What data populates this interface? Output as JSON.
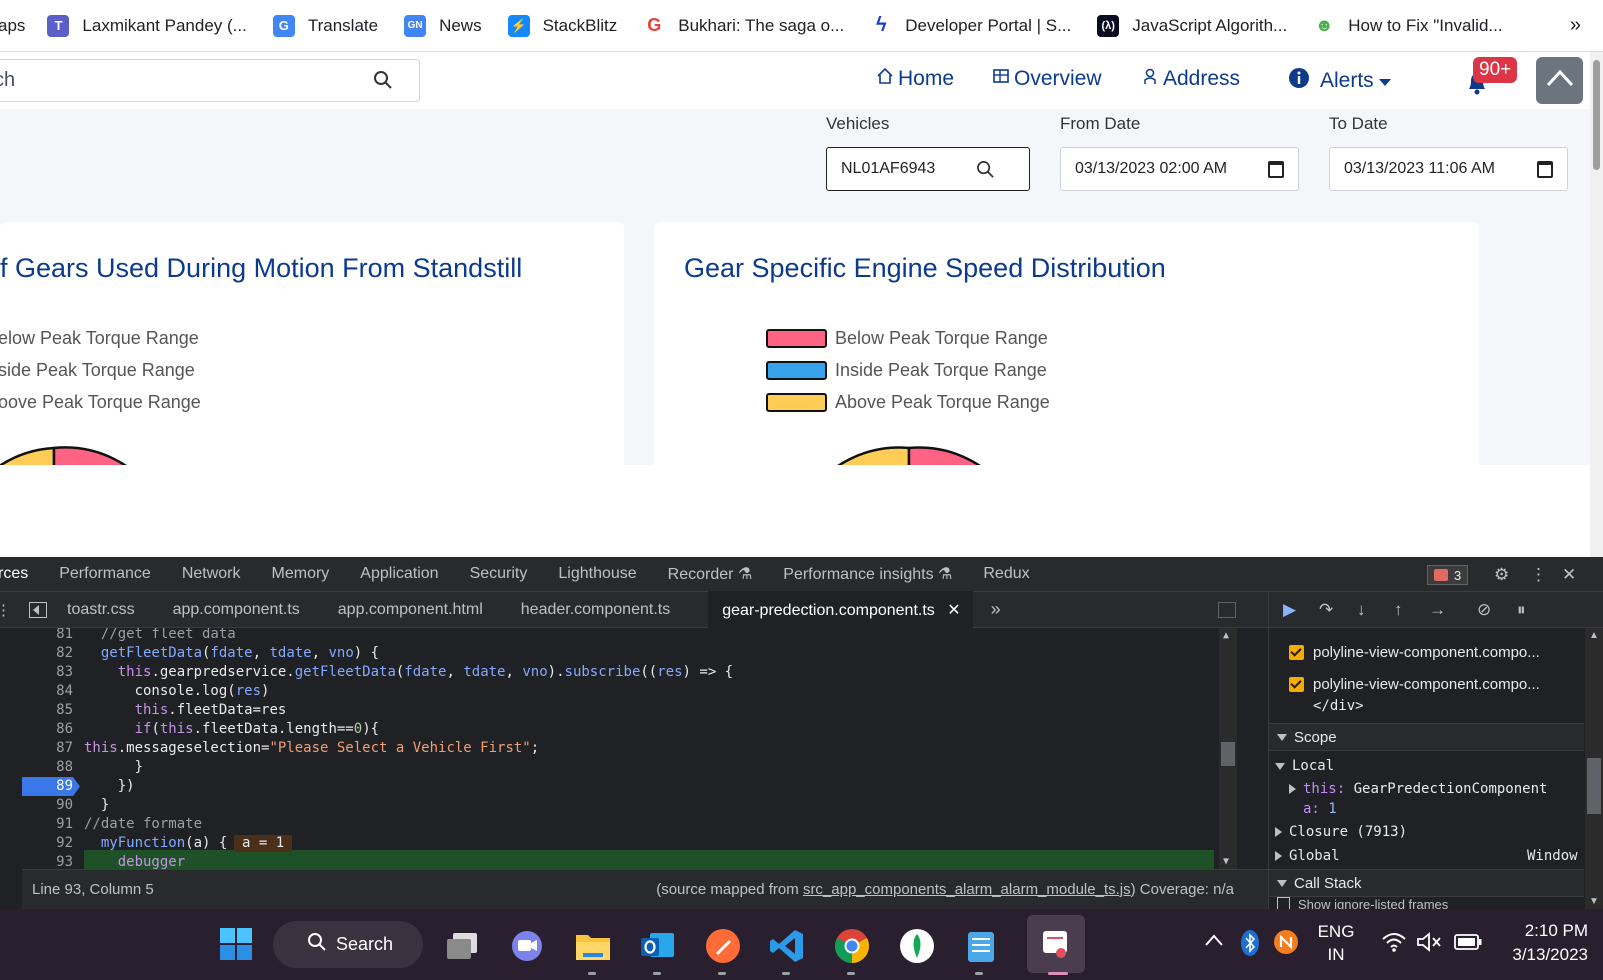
{
  "bookmarks": {
    "items": [
      {
        "label": "aps",
        "icon": "none"
      },
      {
        "label": "Laxmikant Pandey (...",
        "icon": "teams-icon",
        "color": "#5b5fc7"
      },
      {
        "label": "Translate",
        "icon": "translate-icon",
        "color": "#4285f4"
      },
      {
        "label": "News",
        "icon": "news-icon",
        "color": "#4285f4"
      },
      {
        "label": "StackBlitz",
        "icon": "stackblitz-icon",
        "color": "#1389fd"
      },
      {
        "label": "Bukhari: The saga o...",
        "icon": "google-icon",
        "color": "#ea4335"
      },
      {
        "label": "Developer Portal | S...",
        "icon": "lightning-icon",
        "color": "#1a3fc7"
      },
      {
        "label": "JavaScript Algorith...",
        "icon": "freecodecamp-icon",
        "color": "#0a0a23"
      },
      {
        "label": "How to Fix \"Invalid...",
        "icon": "hacker-icon",
        "color": "#4caf50"
      }
    ],
    "more": "»"
  },
  "header": {
    "search_value": "ch",
    "nav": {
      "home": "Home",
      "overview": "Overview",
      "address": "Address",
      "alerts": "Alerts"
    },
    "alerts_badge": "90+"
  },
  "filters": {
    "vehicles_label": "Vehicles",
    "vehicle_value": "NL01AF6943",
    "from_label": "From Date",
    "from_value": "03/13/2023 02:00  AM",
    "to_label": "To Date",
    "to_value": "03/13/2023 11:06  AM"
  },
  "cards": {
    "left_title": "f Gears Used During Motion From Standstill",
    "left_legend": [
      "elow Peak Torque Range",
      "side Peak Torque Range",
      "oove Peak Torque Range"
    ],
    "right_title": "Gear Specific Engine Speed Distribution",
    "right_legend": [
      "Below Peak Torque Range",
      "Inside Peak Torque Range",
      "Above Peak Torque Range"
    ]
  },
  "colors": {
    "below": "#ff6384",
    "inside": "#36a2eb",
    "above": "#ffcd56",
    "accent": "#0d3b8c"
  },
  "devtools": {
    "tabs": [
      "rces",
      "Performance",
      "Network",
      "Memory",
      "Application",
      "Security",
      "Lighthouse",
      "Recorder",
      "Performance insights",
      "Redux"
    ],
    "error_count": "3",
    "file_tabs": [
      "toastr.css",
      "app.component.ts",
      "app.component.html",
      "header.component.ts",
      "gear-predection.component.ts"
    ],
    "active_file": "gear-predection.component.ts",
    "lines": [
      {
        "n": "81",
        "t": "  //get fleet data"
      },
      {
        "n": "82",
        "t": "  getFleetData(fdate, tdate, vno) {"
      },
      {
        "n": "83",
        "t": "    this.gearpredservice.getFleetData(fdate, tdate, vno).subscribe((res) => {"
      },
      {
        "n": "84",
        "t": "      console.log(res)"
      },
      {
        "n": "85",
        "t": "      this.fleetData=res"
      },
      {
        "n": "86",
        "t": "      if(this.fleetData.length==0){"
      },
      {
        "n": "87",
        "t": "this.messageselection=\"Please Select a Vehicle First\";"
      },
      {
        "n": "88",
        "t": "      }"
      },
      {
        "n": "89",
        "t": "    })"
      },
      {
        "n": "90",
        "t": "  }"
      },
      {
        "n": "91",
        "t": "//date formate"
      },
      {
        "n": "92",
        "t": "  myFunction(a) {"
      },
      {
        "n": "93",
        "t": "    debugger"
      }
    ],
    "inline_value": "a = 1",
    "status_left": "Line 93, Column 5",
    "status_right_prefix": "(source mapped from ",
    "status_source": "src_app_components_alarm_alarm_module_ts.js",
    "status_right_suffix": ")  Coverage: n/a",
    "breakpoints": [
      "polyline-view-component.compo...",
      "polyline-view-component.compo..."
    ],
    "bp_sub": "</div>",
    "scope_label": "Scope",
    "local_label": "Local",
    "this_key": "this:",
    "this_value": "GearPredectionComponent",
    "a_key": "a:",
    "a_value": "1",
    "closure": "Closure (7913)",
    "global": "Global",
    "global_value": "Window",
    "call_stack": "Call Stack",
    "ignore_frames": "Show ignore-listed frames"
  },
  "taskbar": {
    "search": "Search",
    "lang1": "ENG",
    "lang2": "IN",
    "time": "2:10 PM",
    "date": "3/13/2023"
  }
}
